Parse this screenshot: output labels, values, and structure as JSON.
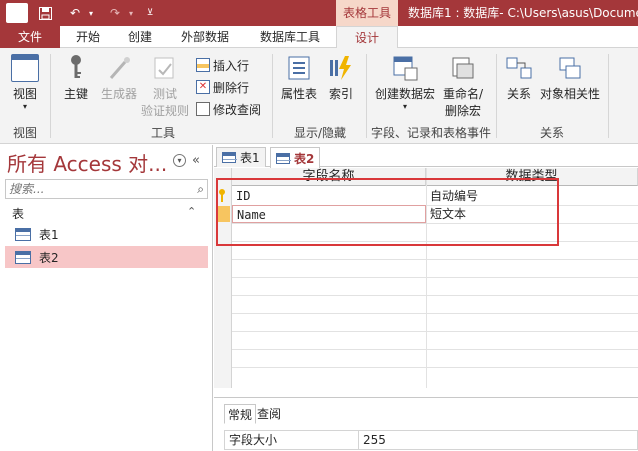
{
  "titlebar": {
    "app_icon": "A",
    "contextual_tab": "表格工具",
    "title": "数据库1 : 数据库- C:\\Users\\asus\\Docume"
  },
  "tabs": [
    "文件",
    "开始",
    "创建",
    "外部数据",
    "数据库工具",
    "设计"
  ],
  "ribbon": {
    "view": "视图",
    "primary_key": "主键",
    "builder": "生成器",
    "test_rules_1": "测试",
    "test_rules_2": "验证规则",
    "insert_rows": "插入行",
    "delete_rows": "删除行",
    "modify_lookups": "修改查阅",
    "property_sheet": "属性表",
    "indexes": "索引",
    "create_macro": "创建数据宏",
    "rename_macro_1": "重命名/",
    "rename_macro_2": "删除宏",
    "relationships": "关系",
    "object_dependencies": "对象相关性",
    "groups": {
      "views": "视图",
      "tools": "工具",
      "show_hide": "显示/隐藏",
      "field_events": "字段、记录和表格事件",
      "relationships": "关系"
    }
  },
  "nav": {
    "title": "所有 Access 对...",
    "search_placeholder": "搜索...",
    "group": "表",
    "items": [
      "表1",
      "表2"
    ]
  },
  "doc_tabs": [
    "表1",
    "表2"
  ],
  "grid": {
    "headers": [
      "字段名称",
      "数据类型"
    ],
    "rows": [
      {
        "name": "ID",
        "type": "自动编号"
      },
      {
        "name": "Name",
        "type": "短文本"
      }
    ]
  },
  "props": {
    "tabs": [
      "常规",
      "查阅"
    ],
    "rows": [
      {
        "key": "字段大小",
        "value": "255"
      }
    ]
  }
}
